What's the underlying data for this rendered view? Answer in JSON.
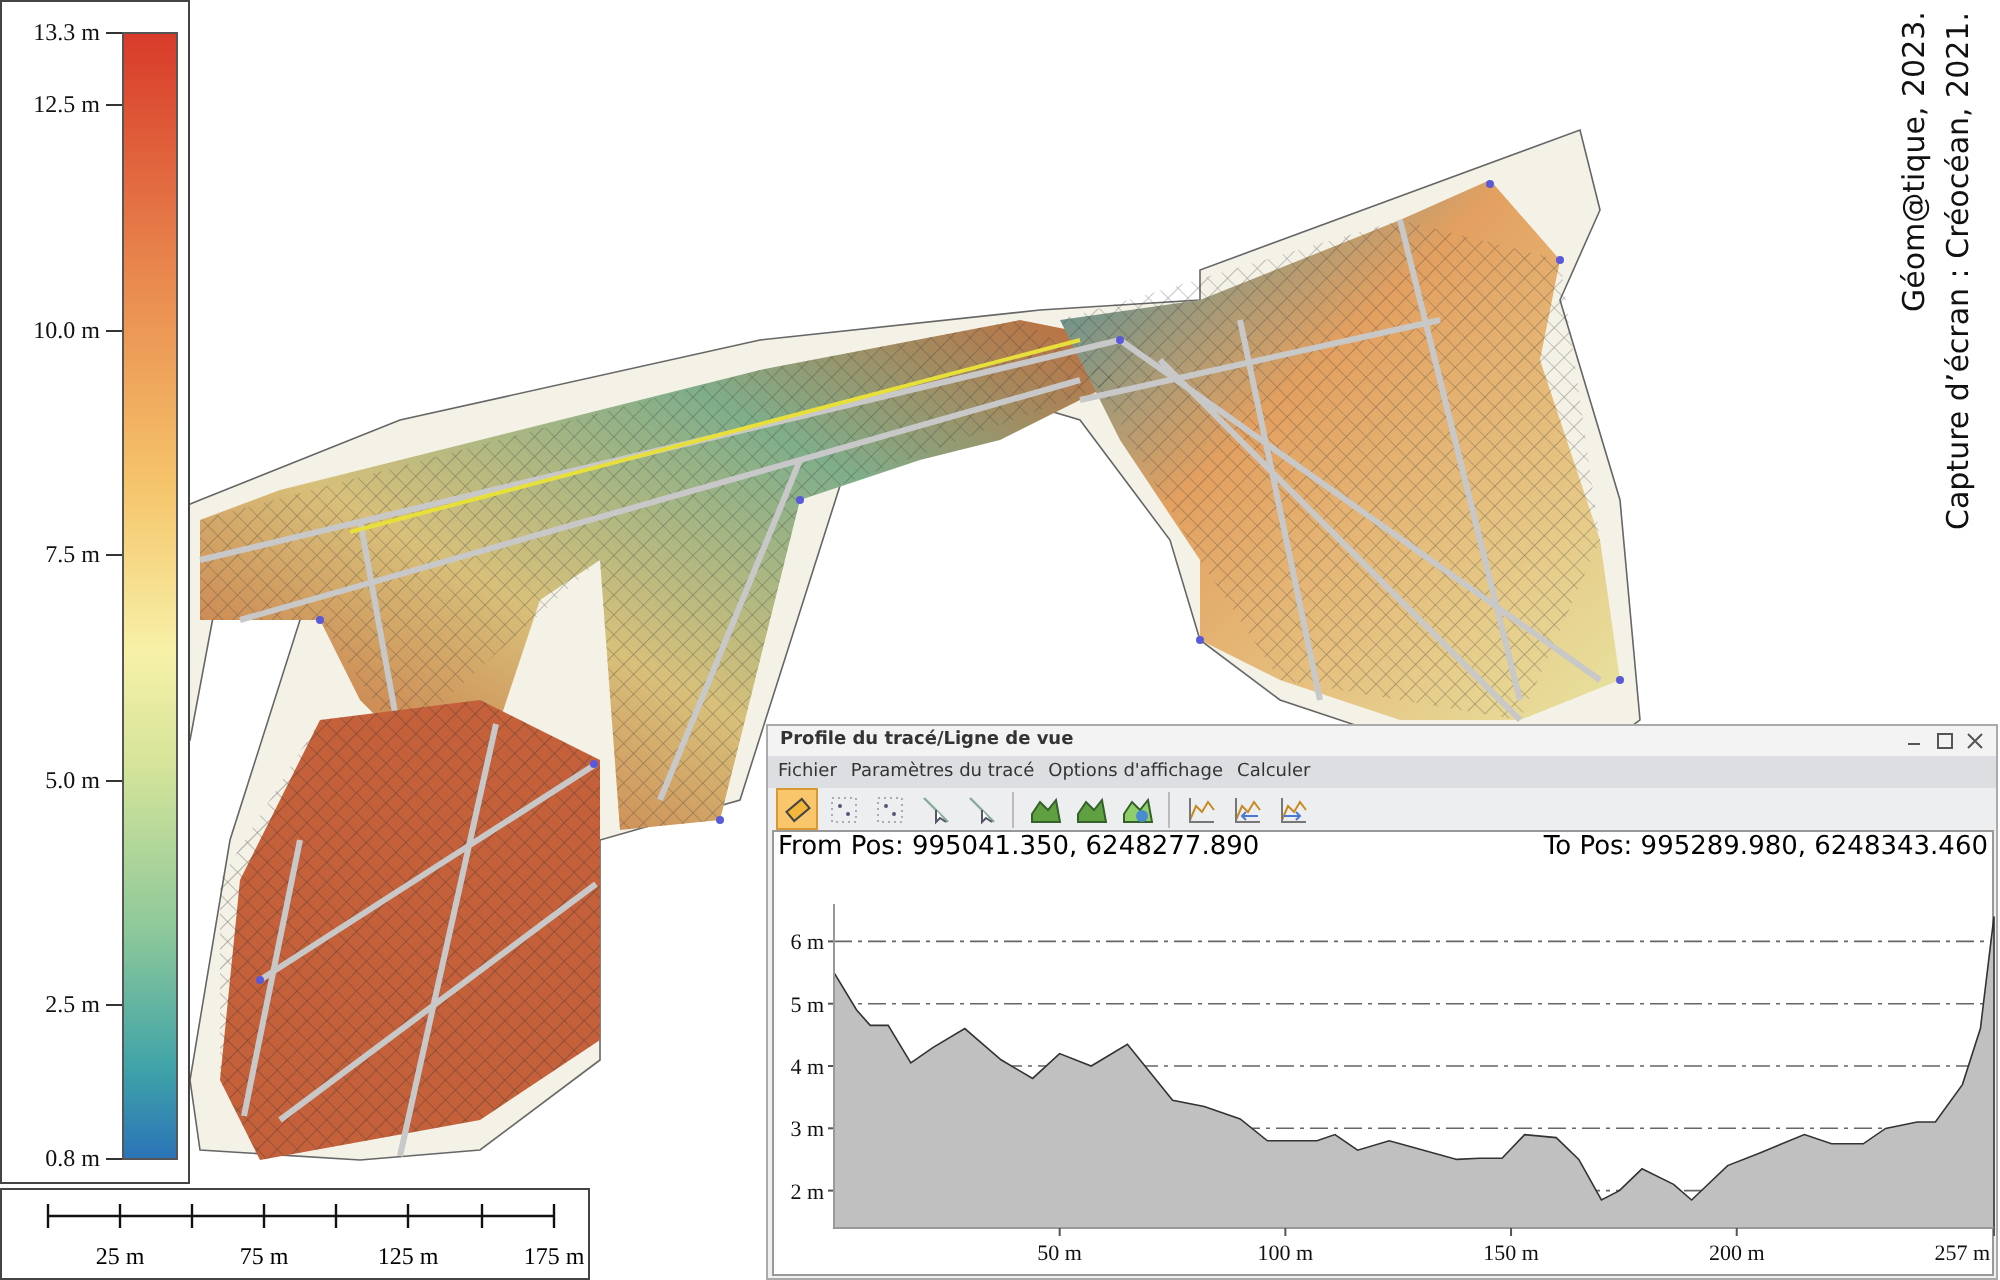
{
  "legend": {
    "ticks": [
      "13.3 m",
      "12.5 m",
      "10.0 m",
      "7.5 m",
      "5.0 m",
      "2.5 m",
      "0.8 m"
    ]
  },
  "scale_bar": {
    "labels": [
      "25 m",
      "75 m",
      "125 m",
      "175 m"
    ]
  },
  "credit": [
    "Géom@tique, 2023.",
    "Capture d’écran : Créocéan, 2021."
  ],
  "profile_window": {
    "title": "Profile du tracé/Ligne de vue",
    "menu": [
      "Fichier",
      "Paramètres du tracé",
      "Options d'affichage",
      "Calculer"
    ],
    "toolbar": {
      "groups": [
        [
          {
            "selected": true
          },
          {
            "selected": false
          },
          {
            "selected": false
          },
          {
            "selected": false
          },
          {
            "selected": false
          }
        ],
        [
          {
            "selected": false
          },
          {
            "selected": false
          },
          {
            "selected": false
          }
        ],
        [
          {
            "selected": false
          },
          {
            "selected": false
          },
          {
            "selected": false
          }
        ]
      ]
    },
    "from_pos": "From Pos: 995041.350, 6248277.890",
    "to_pos": "To Pos: 995289.980, 6248343.460",
    "chart_data": {
      "type": "area",
      "grid": true,
      "xlim": [
        0,
        257
      ],
      "ylim": [
        1.4,
        6.6
      ],
      "xticks": [
        {
          "value": 50,
          "label": "50 m"
        },
        {
          "value": 100,
          "label": "100 m"
        },
        {
          "value": 150,
          "label": "150 m"
        },
        {
          "value": 200,
          "label": "200 m"
        },
        {
          "value": 257,
          "label": "257 m"
        }
      ],
      "yticks": [
        {
          "value": 2,
          "label": "2 m"
        },
        {
          "value": 3,
          "label": "3 m"
        },
        {
          "value": 4,
          "label": "4 m"
        },
        {
          "value": 5,
          "label": "5 m"
        },
        {
          "value": 6,
          "label": "6 m"
        }
      ],
      "x": [
        0,
        5,
        8,
        12,
        17,
        22,
        29,
        37,
        44,
        50,
        57,
        65,
        70,
        75,
        82,
        90,
        96,
        107,
        111,
        116,
        123,
        128,
        138,
        143,
        148,
        153,
        160,
        165,
        170,
        174,
        179,
        186,
        190,
        198,
        205,
        215,
        221,
        228,
        233,
        240,
        244,
        250,
        254,
        257
      ],
      "series": [
        {
          "color": "#c0c0c0",
          "values": [
            5.5,
            4.9,
            4.65,
            4.65,
            4.05,
            4.3,
            4.6,
            4.1,
            3.8,
            4.2,
            4.0,
            4.35,
            3.9,
            3.45,
            3.35,
            3.15,
            2.8,
            2.8,
            2.9,
            2.65,
            2.8,
            2.7,
            2.5,
            2.52,
            2.52,
            2.9,
            2.85,
            2.5,
            1.85,
            2.0,
            2.35,
            2.1,
            1.85,
            2.4,
            2.6,
            2.9,
            2.75,
            2.75,
            3.0,
            3.1,
            3.1,
            3.7,
            4.6,
            6.4
          ]
        }
      ]
    }
  }
}
